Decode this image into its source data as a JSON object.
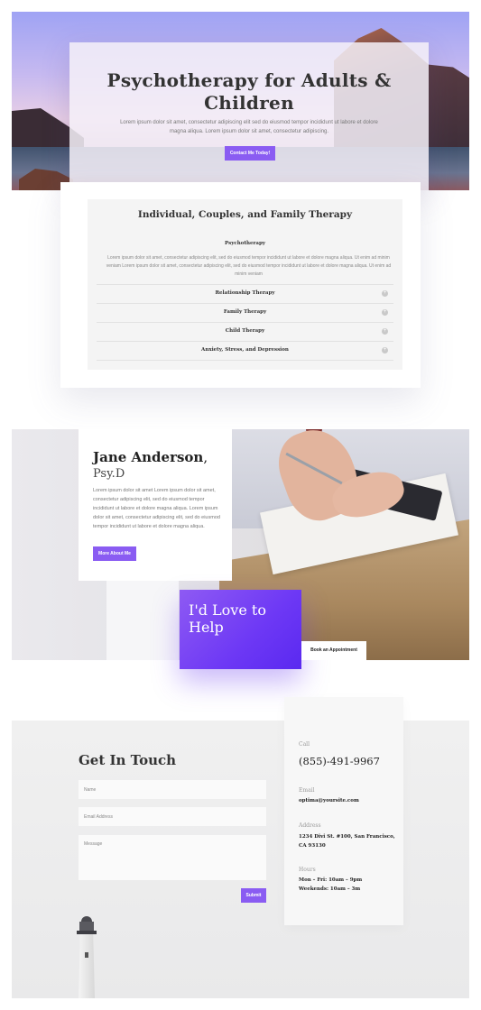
{
  "hero": {
    "title": "Psychotherapy for Adults & Children",
    "text": "Lorem ipsum dolor sit amet, consectetur adipiscing elit sed do eiusmod tempor incididunt ut labore et dolore magna aliqua. Lorem ipsum dolor sit amet, consectetur adipiscing.",
    "button": "Contact Me Today!"
  },
  "services": {
    "title": "Individual, Couples, and Family Therapy",
    "open_item": {
      "title": "Psychotherapy",
      "text": "Lorem ipsum dolor sit amet, consectetur adipiscing elit, sed do eiusmod tempor incididunt ut labore et dolore magna aliqua. Ut enim ad minim veniam Lorem ipsum dolor sit amet, consectetur adipiscing elit, sed do eiusmod tempor incididunt ut labore et dolore magna aliqua. Ut enim ad minim veniam"
    },
    "items": [
      {
        "label": "Relationship Therapy",
        "toggle": "+"
      },
      {
        "label": "Family Therapy",
        "toggle": "+"
      },
      {
        "label": "Child Therapy",
        "toggle": "+"
      },
      {
        "label": "Anxiety, Stress, and Depression",
        "toggle": "+"
      }
    ]
  },
  "about": {
    "name": "Jane Anderson",
    "comma": ",",
    "credential": "Psy.D",
    "text": "Lorem ipsum dolor sit amet Lorem ipsum dolor sit amet, consectetur adipiscing elit, sed do eiusmod tempor incididunt ut labore et dolore magna aliqua. Lorem ipsum dolor sit amet, consectetur adipiscing elit, sed do eiusmod tempor incididunt ut labore et dolore magna aliqua.",
    "button": "More About Me",
    "help": "I'd Love to Help",
    "appointment_button": "Book an Appointment"
  },
  "contact": {
    "title": "Get In Touch",
    "name_placeholder": "Name",
    "email_placeholder": "Email Address",
    "message_placeholder": "Message",
    "submit": "Submit"
  },
  "info": {
    "call_label": "Call",
    "phone": "(855)-491-9967",
    "email_label": "Email",
    "email": "optima@yoursite.com",
    "address_label": "Address",
    "address": "1234 Divi St. #100, San Francisco, CA 93130",
    "hours_label": "Hours",
    "hours_weekday": "Mon – Fri: 10am – 9pm",
    "hours_weekend": "Weekends: 10am – 3m"
  },
  "colors": {
    "accent": "#8a5cf2",
    "help_gradient_end": "#5a29f0"
  }
}
